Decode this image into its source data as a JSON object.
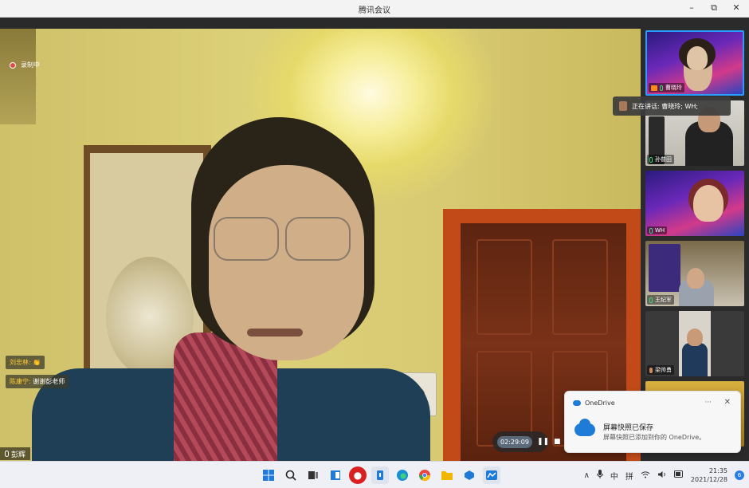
{
  "window": {
    "title": "腾讯会议",
    "minimize": "–",
    "restore": "⧉",
    "close": "✕"
  },
  "recording": {
    "label": "录制中"
  },
  "chat": [
    {
      "who": "刘忠林:",
      "emoji": "👏"
    },
    {
      "who": "陈康宁:",
      "text": "谢谢彭老师"
    }
  ],
  "main_speaker": {
    "name": "彭辉"
  },
  "timer": {
    "time": "02:29:09",
    "pause": "❚❚",
    "stop": "■"
  },
  "speaking_tip": {
    "text": "正在讲话: 曹晓玲; WH;"
  },
  "participants": [
    {
      "name": "曹晓玲"
    },
    {
      "name": "孙普田"
    },
    {
      "name": "WH"
    },
    {
      "name": "王纪军"
    },
    {
      "name": "梁帅勇"
    }
  ],
  "toast": {
    "app": "OneDrive",
    "more": "···",
    "close": "✕",
    "heading": "屏幕快照已保存",
    "body": "屏幕快照已添加到你的 OneDrive。"
  },
  "taskbar": {
    "icons": [
      "windows-start-icon",
      "search-icon",
      "task-view-icon",
      "widgets-icon",
      "media-app-icon",
      "voice-recorder-icon",
      "edge-browser-icon",
      "chrome-browser-icon",
      "file-explorer-icon",
      "store-icon",
      "tencent-meeting-icon"
    ],
    "tray": {
      "chevron": "∧",
      "mic": "🎙",
      "lang": "中",
      "ime": "拼",
      "wifi": "📶",
      "volume": "🔊",
      "battery": "🔋",
      "time": "21:35",
      "date": "2021/12/28",
      "badge": "6"
    }
  }
}
